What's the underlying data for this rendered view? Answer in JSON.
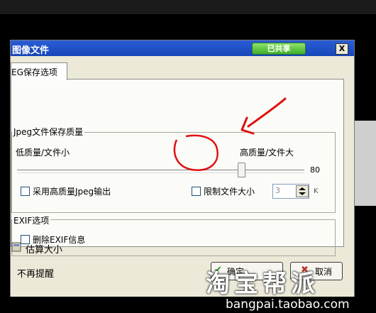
{
  "window": {
    "title": "图像文件",
    "share_button": "已共享",
    "close_glyph": "X"
  },
  "tab": {
    "label": "EG保存选项"
  },
  "quality_group": {
    "title": "Jpeg文件保存质量",
    "low_label": "低质量/文件小",
    "high_label": "高质量/文件大",
    "slider_value": "80",
    "slider_fraction": 0.8,
    "high_quality_checkbox": {
      "label": "采用高质量Jpeg输出",
      "checked": false
    },
    "limit_size_checkbox": {
      "label": "限制文件大小",
      "checked": false
    },
    "size_value": "3",
    "size_unit": "K"
  },
  "exif_group": {
    "title": "EXIF选项",
    "delete_exif_checkbox": {
      "label": "删除EXIF信息",
      "checked": false
    }
  },
  "estimate_size_label": "估算大小",
  "no_remind_label": "不再提醒",
  "ok_button": "确定",
  "cancel_button": "取消",
  "watermark": {
    "logo": "淘宝帮派",
    "url": "bangpai.taobao.com"
  },
  "colors": {
    "titlebar": "#1645b8",
    "share_green": "#3fae2b",
    "annotation_red": "#e01010"
  }
}
